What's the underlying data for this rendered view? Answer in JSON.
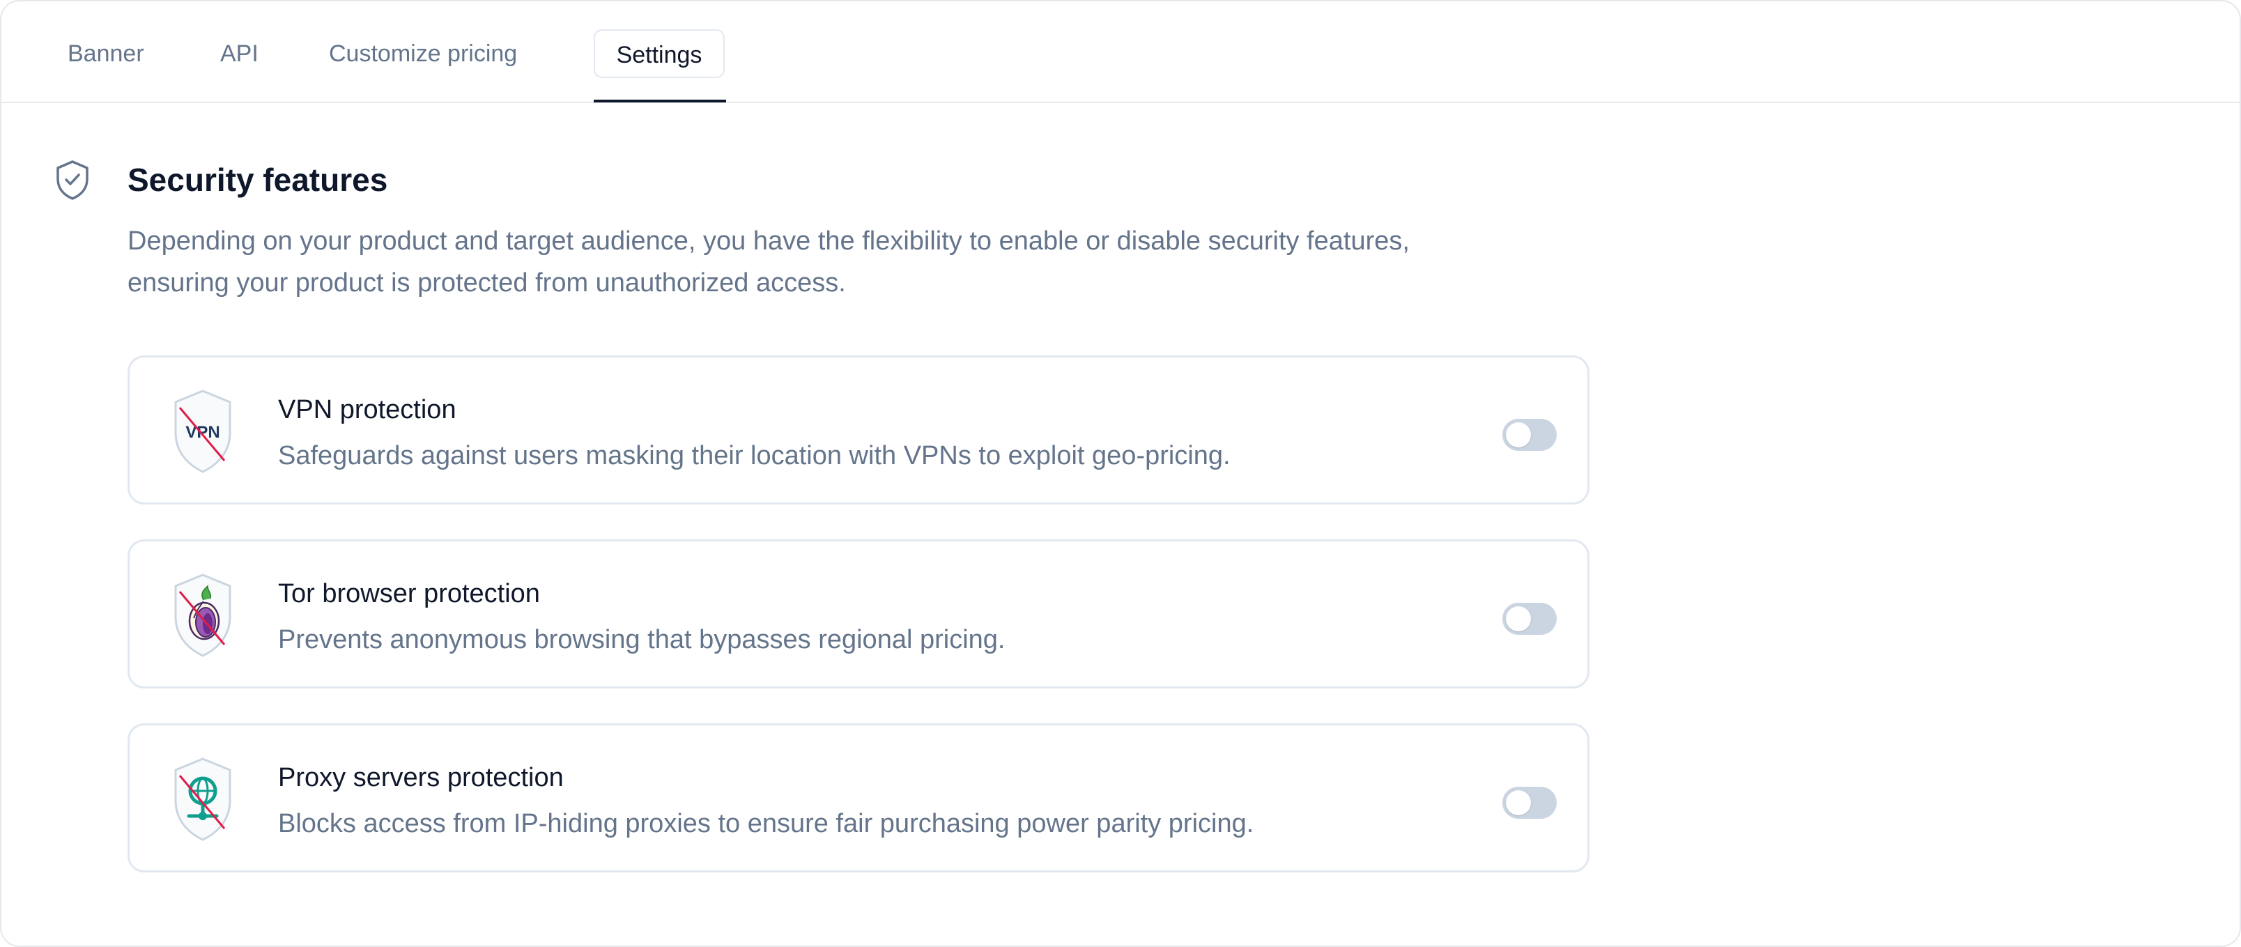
{
  "tabs": [
    {
      "label": "Banner",
      "active": false
    },
    {
      "label": "API",
      "active": false
    },
    {
      "label": "Customize pricing",
      "active": false
    },
    {
      "label": "Settings",
      "active": true
    }
  ],
  "section": {
    "icon": "shield-check-icon",
    "title": "Security features",
    "description": "Depending on your product and target audience, you have the flexibility to enable or disable security features, ensuring your product is protected from unauthorized access."
  },
  "features": [
    {
      "icon": "vpn-blocked-shield-icon",
      "icon_text": "VPN",
      "title": "VPN protection",
      "description": "Safeguards against users masking their location with VPNs to exploit geo-pricing.",
      "enabled": false
    },
    {
      "icon": "tor-blocked-shield-icon",
      "title": "Tor browser protection",
      "description": "Prevents anonymous browsing that bypasses regional pricing.",
      "enabled": false
    },
    {
      "icon": "proxy-blocked-shield-icon",
      "title": "Proxy servers protection",
      "description": "Blocks access from IP-hiding proxies to ensure fair purchasing power parity pricing.",
      "enabled": false
    }
  ],
  "colors": {
    "text_primary": "#0f172a",
    "text_muted": "#64748b",
    "border": "#e2e8f0",
    "toggle_off": "#cbd5e1",
    "slash_red": "#e11d48",
    "tor_purple": "#7e3f98",
    "proxy_teal": "#0f9f8f"
  }
}
